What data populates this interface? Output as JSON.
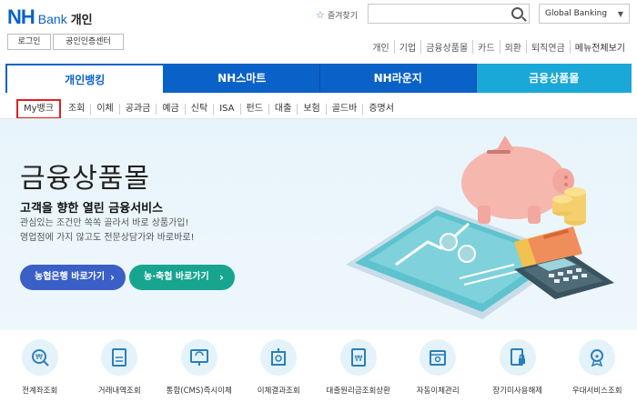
{
  "header": {
    "logo_nh": "NH",
    "logo_bank": "Bank",
    "logo_personal": "개인",
    "favorites": "즐겨찾기",
    "search_placeholder": "",
    "global_banking": "Global Banking",
    "login": "로그인",
    "certificate_center": "공인인증센터"
  },
  "top_nav": {
    "items": [
      "개인",
      "기업",
      "금융상품몰",
      "카드",
      "외환",
      "퇴직연금"
    ],
    "menu_all": "메뉴전체보기"
  },
  "main_tabs": [
    {
      "label": "개인뱅킹",
      "active": true
    },
    {
      "label": "NH스마트",
      "active": false
    },
    {
      "label": "NH라운지",
      "active": false
    },
    {
      "label": "금융상품몰",
      "active": false
    }
  ],
  "sub_tabs": [
    "My뱅크",
    "조회",
    "이체",
    "공과금",
    "예금",
    "신탁",
    "ISA",
    "펀드",
    "대출",
    "보험",
    "골드바",
    "증명서"
  ],
  "hero": {
    "title": "금융상품몰",
    "subtitle": "고객을 향한 열린 금융서비스",
    "desc_line1": "관심있는 조건만 쏙쏙 골라서 바로 상품가입!",
    "desc_line2": "영업점에 가지 않고도 전문상담가와 바로바로!",
    "cta_nh": "농협은행 바로가기",
    "cta_coop": "농·축협 바로가기"
  },
  "quick_menu": [
    {
      "label": "전계좌조회",
      "icon": "won-magnifier-icon"
    },
    {
      "label": "거래내역조회",
      "icon": "document-nh-icon"
    },
    {
      "label": "통합(CMS)즉시이체",
      "icon": "transfer-monitor-icon"
    },
    {
      "label": "이체결과조회",
      "icon": "transfer-result-icon"
    },
    {
      "label": "대출원리금조회상환",
      "icon": "loan-document-icon"
    },
    {
      "label": "자동이체관리",
      "icon": "calendar-gear-icon"
    },
    {
      "label": "장기미사용해제",
      "icon": "document-lock-icon"
    },
    {
      "label": "우대서비스조회",
      "icon": "medal-icon"
    }
  ],
  "colors": {
    "primary": "#0a62c8",
    "mall_tab": "#1aa8d8",
    "cta_nh": "#3a5fc7",
    "cta_coop": "#17a590",
    "highlight": "#e02020"
  }
}
